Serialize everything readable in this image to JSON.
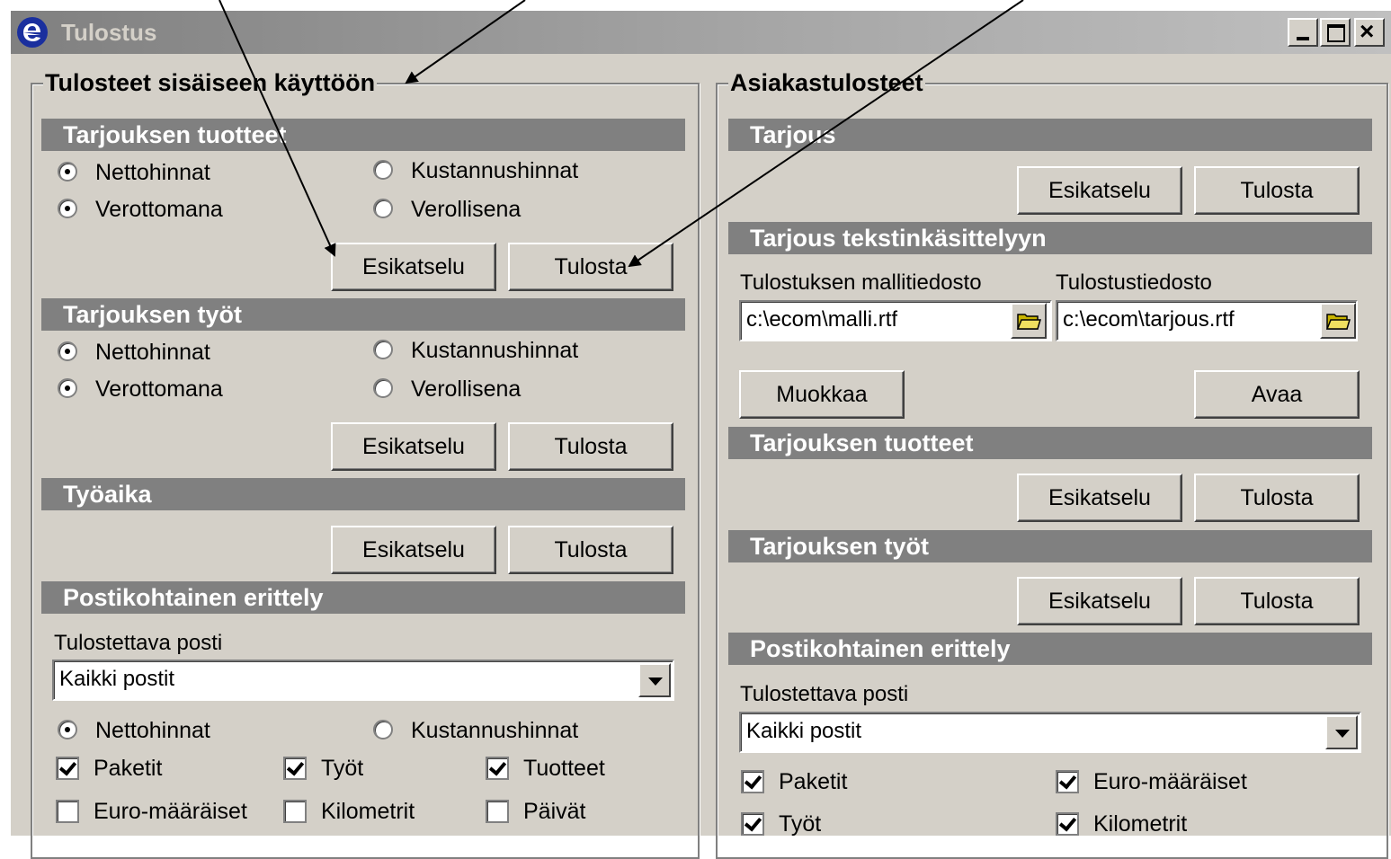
{
  "window": {
    "title": "Tulostus",
    "icon": "ecom-e-icon"
  },
  "left": {
    "group_title": "Tulosteet sisäiseen käyttöön",
    "products": {
      "header": "Tarjouksen tuotteet",
      "netto": "Nettohinnat",
      "kustannus": "Kustannushinnat",
      "verottomana": "Verottomana",
      "verollisena": "Verollisena",
      "preview": "Esikatselu",
      "print": "Tulosta"
    },
    "works": {
      "header": "Tarjouksen työt",
      "netto": "Nettohinnat",
      "kustannus": "Kustannushinnat",
      "verottomana": "Verottomana",
      "verollisena": "Verollisena",
      "preview": "Esikatselu",
      "print": "Tulosta"
    },
    "worktime": {
      "header": "Työaika",
      "preview": "Esikatselu",
      "print": "Tulosta"
    },
    "post": {
      "header": "Postikohtainen erittely",
      "label": "Tulostettava posti",
      "select_value": "Kaikki postit",
      "netto": "Nettohinnat",
      "kustannus": "Kustannushinnat",
      "paketit": "Paketit",
      "tyot": "Työt",
      "tuotteet": "Tuotteet",
      "euro": "Euro-määräiset",
      "kilometrit": "Kilometrit",
      "paivat": "Päivät"
    }
  },
  "right": {
    "group_title": "Asiakastulosteet",
    "offer": {
      "header": "Tarjous",
      "preview": "Esikatselu",
      "print": "Tulosta"
    },
    "wordproc": {
      "header": "Tarjous tekstinkäsittelyyn",
      "template_label": "Tulostuksen mallitiedosto",
      "template_value": "c:\\ecom\\malli.rtf",
      "output_label": "Tulostustiedosto",
      "output_value": "c:\\ecom\\tarjous.rtf",
      "edit": "Muokkaa",
      "open": "Avaa"
    },
    "products": {
      "header": "Tarjouksen tuotteet",
      "preview": "Esikatselu",
      "print": "Tulosta"
    },
    "works": {
      "header": "Tarjouksen työt",
      "preview": "Esikatselu",
      "print": "Tulosta"
    },
    "post": {
      "header": "Postikohtainen erittely",
      "label": "Tulostettava posti",
      "select_value": "Kaikki postit",
      "paketit": "Paketit",
      "euro": "Euro-määräiset",
      "tyot": "Työt",
      "kilometrit": "Kilometrit"
    }
  }
}
